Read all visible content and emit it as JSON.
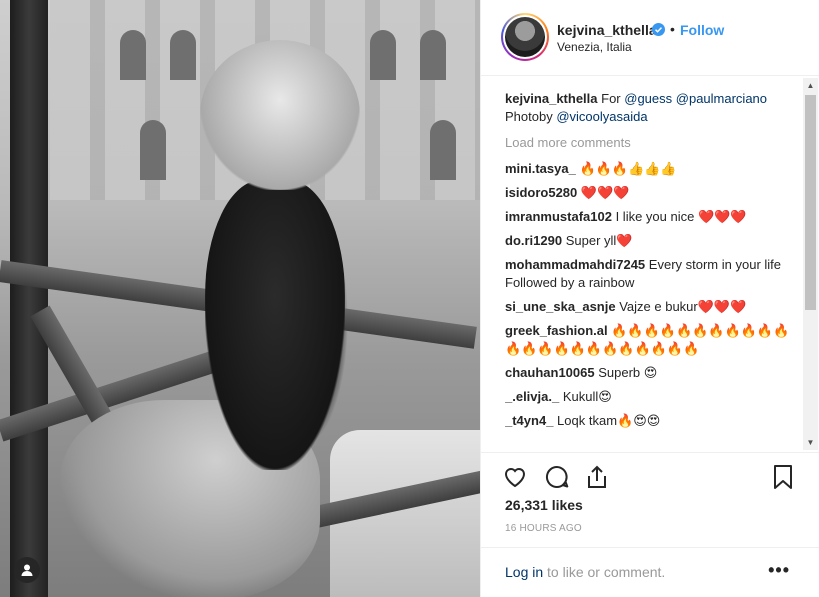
{
  "post": {
    "username": "kejvina_kthella",
    "follow_label": "Follow",
    "location": "Venezia, Italia",
    "caption": {
      "username": "kejvina_kthella",
      "prefix": "For",
      "mention1": "@guess",
      "mention2": "@paulmarciano",
      "line2_prefix": "Photoby",
      "mention3": "@vicoolyasaida"
    },
    "load_more": "Load more comments",
    "comments": [
      {
        "user": "mini.tasya_",
        "text": "🔥🔥🔥👍👍👍"
      },
      {
        "user": "isidoro5280",
        "text": "❤️❤️❤️"
      },
      {
        "user": "imranmustafa102",
        "text": "I like you nice ❤️❤️❤️"
      },
      {
        "user": "do.ri1290",
        "text": "Super yll❤️"
      },
      {
        "user": "mohammadmahdi7245",
        "text": "Every storm in your life"
      },
      {
        "user": "",
        "text": "Followed by a rainbow"
      },
      {
        "user": "si_une_ska_asnje",
        "text": "Vajze e bukur❤️❤️❤️"
      },
      {
        "user": "greek_fashion.al",
        "text": "🔥🔥🔥🔥🔥🔥🔥🔥🔥🔥🔥🔥🔥🔥🔥🔥🔥🔥🔥🔥🔥🔥🔥"
      },
      {
        "user": "chauhan10065",
        "text": "Superb 😍"
      },
      {
        "user": "_.elivja._",
        "text": "Kukull😍"
      },
      {
        "user": "_t4yn4_",
        "text": "Loqk tkam🔥😍😍"
      }
    ],
    "likes": "26,331 likes",
    "time": "16 HOURS AGO",
    "footer": {
      "login_link": "Log in",
      "login_rest": " to like or comment.",
      "more": "•••"
    }
  },
  "icons": {
    "like": "heart-icon",
    "comment": "comment-icon",
    "share": "share-icon",
    "save": "bookmark-icon",
    "tag": "user-tag-icon",
    "verified": "verified-badge-icon"
  }
}
